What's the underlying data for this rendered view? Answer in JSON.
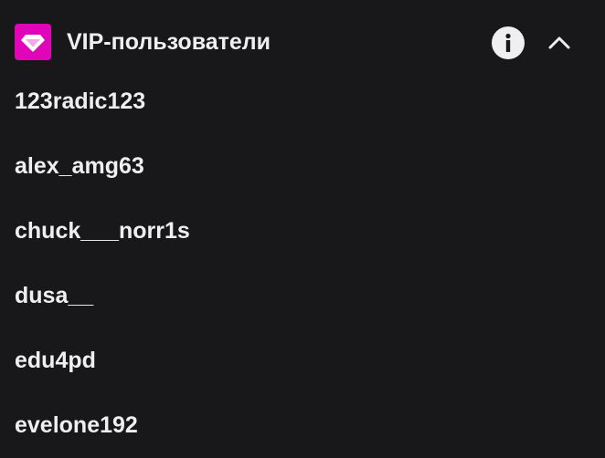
{
  "header": {
    "title": "VIP-пользователи",
    "icon": "vip-gem-icon",
    "info_icon": "info-icon",
    "collapse_icon": "chevron-up-icon"
  },
  "colors": {
    "background": "#18181b",
    "text": "#efeff1",
    "vip_badge": "#e005b9"
  },
  "users": [
    "123radic123",
    "alex_amg63",
    "chuck___norr1s",
    "dusa__",
    "edu4pd",
    "evelone192"
  ]
}
